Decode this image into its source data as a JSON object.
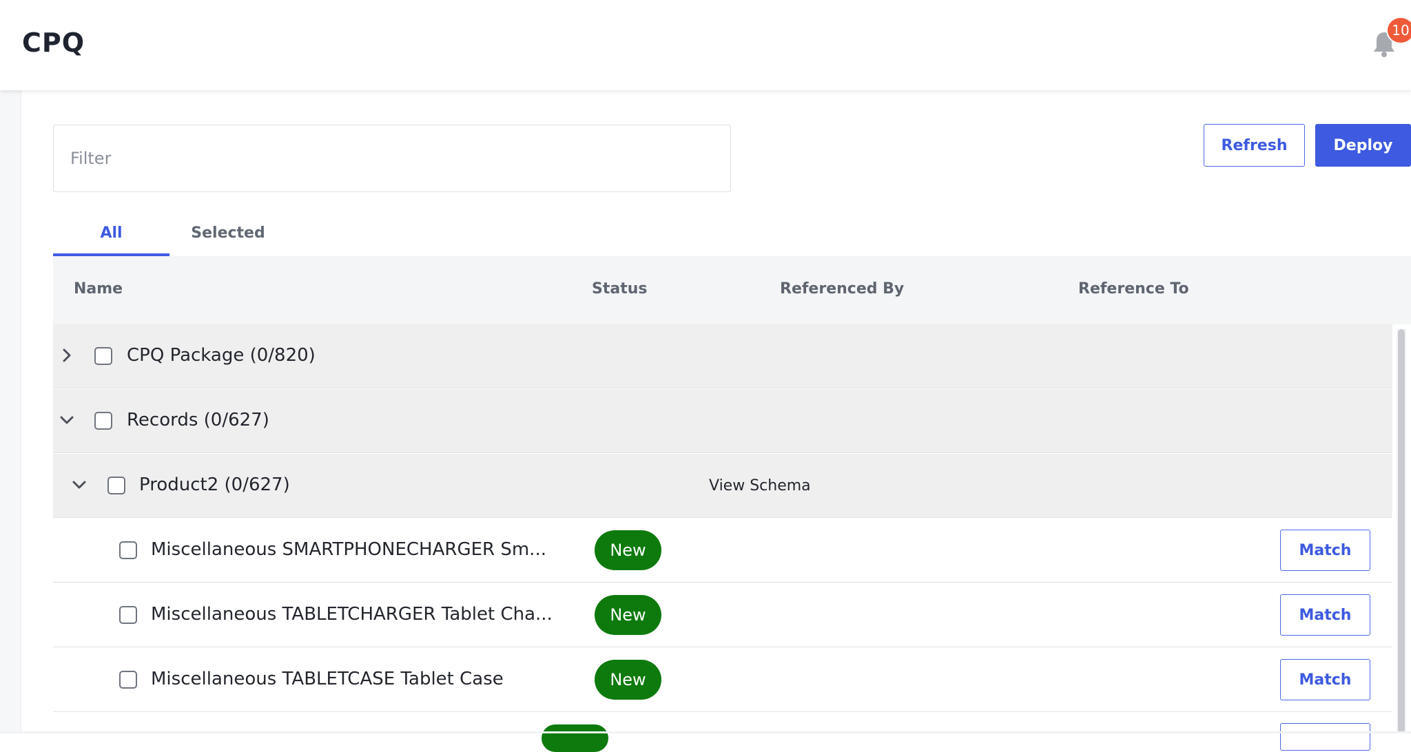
{
  "header": {
    "title": "CPQ",
    "notification_count": "10"
  },
  "toolbar": {
    "filter_placeholder": "Filter",
    "refresh_label": "Refresh",
    "deploy_label": "Deploy"
  },
  "tabs": [
    {
      "label": "All",
      "active": true
    },
    {
      "label": "Selected",
      "active": false
    }
  ],
  "table": {
    "columns": [
      "Name",
      "Status",
      "Referenced By",
      "Reference To"
    ],
    "groups": [
      {
        "label": "CPQ Package (0/820)",
        "expanded": false
      },
      {
        "label": "Records (0/627)",
        "expanded": true
      },
      {
        "label": "Product2 (0/627)",
        "expanded": true,
        "link": "View Schema"
      }
    ],
    "items": [
      {
        "name": "Miscellaneous SMARTPHONECHARGER Sm...",
        "status": "New",
        "action": "Match"
      },
      {
        "name": "Miscellaneous TABLETCHARGER Tablet Cha...",
        "status": "New",
        "action": "Match"
      },
      {
        "name": "Miscellaneous TABLETCASE Tablet Case",
        "status": "New",
        "action": "Match"
      }
    ]
  },
  "colors": {
    "accent": "#3d5ae0",
    "status_new": "#0e7a0d",
    "badge": "#ef5a39"
  }
}
